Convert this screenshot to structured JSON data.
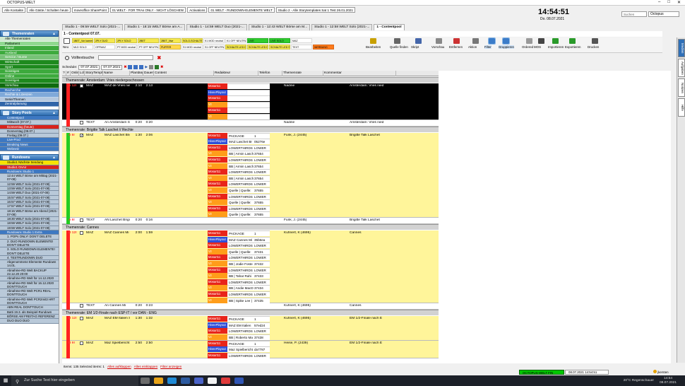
{
  "window": {
    "title": "OCTOPUS-WELT"
  },
  "shortcuts": [
    "Alle Kontakte",
    "Alle Gäste / Schalten heute",
    "moveoffice SharePoint",
    "01 WELT - FOR TRAs ONLY - NICHT LÖSCHEN!",
    "Activations",
    "01 WELT - RUNDOWN-ELEMENTE WELT",
    "Studio 2 - Alle Storytemplates Sat 1 Test 26.01.2021"
  ],
  "clock": {
    "time": "14:54:51",
    "date": "Do. 08.07.2021"
  },
  "top_search": {
    "placeholder": "Suchen",
    "selected": "Octopus"
  },
  "tabs": [
    {
      "label": "Studio 1 - 09:59 WELT Solo (2021-...",
      "active": false
    },
    {
      "label": "Studio 1 - 18:15 WELT Börse am A...",
      "active": false
    },
    {
      "label": "Studio 1 - 14:59 WELT Duo (2021-...",
      "active": false
    },
    {
      "label": "Studio 1 - 12:43 WELT Börse am M...",
      "active": false
    },
    {
      "label": "Studio 1 - 12:58 WELT Solo (2021-...",
      "active": false
    },
    {
      "label": "1 - Contentpool",
      "active": true
    }
  ],
  "contentpool_header": "1 - Contentpool 07.07.",
  "toolbar": {
    "neu": "Neu",
    "buttons": [
      {
        "label": "1BET_Vor kamera 1",
        "color": "#f5e84e"
      },
      {
        "label": "2PLY DUO",
        "color": "#f5e84e"
      },
      {
        "label": "2PLY SOLO",
        "color": "#f5e84e"
      },
      {
        "label": "2BET",
        "color": "#f5e84e"
      },
      {
        "label": "2BET_Nwr",
        "color": "#f5e84e"
      },
      {
        "label": "SOLO-SCHALTE",
        "color": "#f5e84e"
      },
      {
        "label": "K1 MOD neutral",
        "color": "#ffffff"
      },
      {
        "label": "K1 OFF NEUTRAL",
        "color": "#ffffff"
      },
      {
        "label": "LIVE",
        "color": "#2ecc2e"
      },
      {
        "label": "LIVE SOLO",
        "color": "#2ecc2e"
      },
      {
        "label": "MAZ",
        "color": "#ffffff"
      },
      {
        "label": "MLD SOLO",
        "color": "#ffffff"
      },
      {
        "label": "OFFMAZ",
        "color": "#ffffff"
      },
      {
        "label": "PT MOD neutral",
        "color": "#ffffff"
      },
      {
        "label": "PT OFF NEUTRAL",
        "color": "#ffffff"
      },
      {
        "label": "PUFFER",
        "color": "#ffd84a"
      },
      {
        "label": "S1 MOD neutral",
        "color": "#ffffff"
      },
      {
        "label": "S1 OFF NEUTRAL",
        "color": "#ffffff"
      },
      {
        "label": "SCHALTE LED DEFAULT",
        "color": "#f5e84e"
      },
      {
        "label": "SCHALTE LED DUO SLED",
        "color": "#f5e84e"
      },
      {
        "label": "SCHALTE LED SOLO SLED",
        "color": "#f5e84e"
      },
      {
        "label": "TEXT",
        "color": "#ffffff"
      },
      {
        "label": "WERBUNG",
        "color": "#ff7a1a"
      }
    ],
    "actions": [
      "Bearbeiten",
      "Quelle finden",
      "Skript",
      "Vorschau",
      "Entfernen",
      "Aktion",
      "Filter",
      "Gruppieren",
      "Ordered",
      "MOS",
      "Importieren",
      "Exportieren",
      "Drucken"
    ],
    "volltext": "Volltextsuche"
  },
  "schedule": {
    "label": "Schedule:",
    "from": "07.07.2021",
    "to": "07.07.2021"
  },
  "sidebar": {
    "themen_header": "Themenraten",
    "themen": [
      {
        "label": "Alle Themenraten",
        "color": "#cfe8d0",
        "text": "#000"
      },
      {
        "label": "Parlament",
        "color": "#8fd88f",
        "text": "#000"
      },
      {
        "label": "Inland",
        "color": "#3daa3d",
        "text": "#fff"
      },
      {
        "label": "Ausland",
        "color": "#3daa3d",
        "text": "#fff"
      },
      {
        "label": "Service / Bunte",
        "color": "#77c277",
        "text": "#fff"
      },
      {
        "label": "Wirtschaft",
        "color": "#1e8a1e",
        "text": "#fff"
      },
      {
        "label": "Sport",
        "color": "#1e8a1e",
        "text": "#fff"
      },
      {
        "label": "Sonstiges",
        "color": "#3daa3d",
        "text": "#fff"
      },
      {
        "label": "Online",
        "color": "#3daa3d",
        "text": "#fff"
      },
      {
        "label": "Sonstiges",
        "color": "#1e8a1e",
        "text": "#fff"
      },
      {
        "label": "Vorschau",
        "color": "#0f6b0f",
        "text": "#fff"
      },
      {
        "label": "Recherche",
        "color": "#3d78c2",
        "text": "#fff"
      },
      {
        "label": "Rechte & Lizenzen",
        "color": "#7fa9d9",
        "text": "#fff"
      },
      {
        "label": "Serie/Themen",
        "color": "#b5c8de",
        "text": "#000"
      },
      {
        "label": "Zentralplanung",
        "color": "#2f64a8",
        "text": "#fff"
      }
    ],
    "story_header": "Story Pools",
    "storypools": [
      {
        "label": "Contentpool",
        "cls": "blue"
      },
      {
        "label": "Mittwoch (07.07.)",
        "cls": ""
      },
      {
        "label": "Donnerstag (heute)",
        "cls": "red"
      },
      {
        "label": "Donnerstag (08.07.)",
        "cls": ""
      },
      {
        "label": "Freitag (09.07.)",
        "cls": ""
      },
      {
        "label": "Live-Prod",
        "cls": "blue"
      },
      {
        "label": "Breaking News",
        "cls": "blue"
      },
      {
        "label": "Webnetz",
        "cls": "blue"
      }
    ],
    "rundown_header": "Rundowns",
    "rundowns": [
      {
        "label": "Studio1 Nächste Sendung",
        "cls": "yellow"
      },
      {
        "label": "Studio1 OnAir",
        "cls": "red"
      },
      {
        "label": "Rundowns Studio 1",
        "cls": "blue"
      },
      {
        "label": "12:44 WELT Börse am Mittag (2021-07-08)",
        "cls": ""
      },
      {
        "label": "12:59 WELT Solo (2021-07-08)",
        "cls": ""
      },
      {
        "label": "13:59 WELT Solo (2021-07-08)",
        "cls": ""
      },
      {
        "label": "14:59 WELT Duo (2021-07-08)",
        "cls": ""
      },
      {
        "label": "15:57 WELT Solo (2021-07-08)",
        "cls": ""
      },
      {
        "label": "16:57 WELT Solo (2021-07-08)",
        "cls": ""
      },
      {
        "label": "17:57 WELT Solo (2021-07-08)",
        "cls": ""
      },
      {
        "label": "18:15 WELT Börse am Abend (2021-07-08)",
        "cls": ""
      },
      {
        "label": "18:30 WELT Solo (2021-07-08)",
        "cls": ""
      },
      {
        "label": "18:59 WELT Solo (2021-07-08)",
        "cls": ""
      },
      {
        "label": "19:59 WELT Solo (2021-07-08)",
        "cls": ""
      },
      {
        "label": "Rundowns Studio 1 Extra",
        "cls": "blue"
      },
      {
        "label": "1. POPs ONLY! DON'T DELETE",
        "cls": ""
      },
      {
        "label": "2. DUO RUNDOWN ELEMENTE! DON'T DELETE",
        "cls": ""
      },
      {
        "label": "3. SOLO RUNDOWN ELEMENTE! DON'T DELETE",
        "cls": ""
      },
      {
        "label": "4. TESTRUNDOWN DUO",
        "cls": ""
      },
      {
        "label": "Abgenommene Elemente Rundown 14.01.",
        "cls": ""
      },
      {
        "label": "Abnahme-RD Welt BACKUP 22.12.20 20:00",
        "cls": ""
      },
      {
        "label": "Abnahme-RD Welt für 14.12.2020",
        "cls": ""
      },
      {
        "label": "Abnahme-RD Welt für 16.12.2020 DONTTOUCH",
        "cls": ""
      },
      {
        "label": "Abnahme-RD Welt PCR1 REAL DONTTOUCH",
        "cls": ""
      },
      {
        "label": "Abnahme-RD Welt PCR2mit3 HRT DONTTOUCH",
        "cls": ""
      },
      {
        "label": "ABN REAL DONTTOUCH",
        "cls": ""
      },
      {
        "label": "Batti 19.3. als Beispiel-Rundown",
        "cls": ""
      },
      {
        "label": "BÖRSE AM FREITAG REFERENZ",
        "cls": ""
      },
      {
        "label": "DUO DUO DUO",
        "cls": ""
      }
    ]
  },
  "grid": {
    "columns": [
      "?",
      "#",
      "Online",
      "Lck",
      "StoryTemplate",
      "Name",
      "Plantänge",
      "Dauer",
      "Content",
      "Redakteur",
      "Telefon",
      "Themenrate",
      "Kommentar"
    ],
    "sections": [
      {
        "title": "Themenrate: Amsterdam: Vries niedergeschossen",
        "rows": [
          {
            "bg": "#000000",
            "fg": "#ffffff",
            "lane": "#ff2020",
            "flag": "A 12!",
            "template": "MAZ",
            "name": "MAZ de Vries niedergesch",
            "plan": "2:10",
            "dur": "2:13",
            "redakteur": "Nadine",
            "thema": "Amsterdam: Vries nied",
            "checked": false,
            "content": [
              [
                "Mosart11",
                "PACKAGE",
                "1"
              ],
              [
                "HiveePlayout",
                "MAZ de Vries nied",
                "4953e"
              ],
              [
                "Mosart11",
                "LOWERTHIRDS",
                "LOWER"
              ],
              [
                "Vz",
                "BB | Ursula von",
                "37473"
              ],
              [
                "Mosart11",
                "LOWERTHIRDS",
                "LOWER"
              ],
              [
                "Vz",
                "BB | König Willem",
                "37474"
              ]
            ]
          },
          {
            "bg": "#ffffff",
            "fg": "#000",
            "lane": "#ff2020",
            "flag": "",
            "template": "TEXT",
            "name": "An Amsterdam Schusse",
            "plan": "0:20",
            "dur": "0:20",
            "redakteur": "Nadine",
            "thema": "Amsterdam: Vries nied",
            "checked": false,
            "content": []
          }
        ]
      },
      {
        "title": "Themenrate: Brigitte Talk Laschet // Rechte",
        "rows": [
          {
            "bg": "#fff59a",
            "fg": "#000",
            "lane": "#22cc22",
            "flag": "A 6!",
            "template": "MAZ",
            "name": "MAZ Laschet Brigitte Tal",
            "plan": "1:30",
            "dur": "2:06",
            "redakteur": "Funk, J. (2445)",
            "thema": "Brigitte Talk Laschet",
            "checked": true,
            "content": [
              [
                "Mosart11",
                "PACKAGE",
                "1"
              ],
              [
                "HiveePlayout",
                "MAZ Laschet Br",
                "05276e"
              ],
              [
                "Mosart11",
                "LOWERTHIRDS",
                "LOWER"
              ],
              [
                "Vz",
                "BB | Armin Lasch",
                "37654"
              ],
              [
                "Mosart11",
                "LOWERTHIRDS",
                "LOWER"
              ],
              [
                "Vz",
                "BB | Armin Lasch",
                "37654"
              ],
              [
                "Mosart11",
                "LOWERTHIRDS",
                "LOWER"
              ],
              [
                "Vz",
                "BB | Armin Lasch",
                "37654"
              ],
              [
                "Mosart11",
                "LOWERTHIRDS",
                "LOWER"
              ],
              [
                "Vz",
                "Quelle | Quelle:",
                "37655"
              ],
              [
                "Mosart11",
                "LOWERTHIRDS",
                "LOWER"
              ],
              [
                "Vz",
                "Quelle | Quelle:",
                "37655"
              ],
              [
                "Mosart11",
                "LOWERTHIRDS",
                "LOWER"
              ],
              [
                "Vz",
                "Quelle | Quelle:",
                "37655"
              ]
            ]
          },
          {
            "bg": "#ffffff",
            "fg": "#000",
            "lane": "#22cc22",
            "flag": "A 6!",
            "template": "TEXT",
            "name": "AN Laschet Brigitte Talk",
            "plan": "0:20",
            "dur": "0:16",
            "redakteur": "Funk, J. (2445)",
            "thema": "Brigitte Talk Laschet",
            "checked": false,
            "content": []
          }
        ]
      },
      {
        "title": "Themenrate: Cannes",
        "rows": [
          {
            "bg": "#fff59a",
            "fg": "#000",
            "lane": "#ff2020",
            "flag": "B 12!",
            "template": "MAZ",
            "name": "MAZ Cannes Mi 1005",
            "plan": "2:00",
            "dur": "1:59",
            "redakteur": "Kuhnert, K (4695)",
            "thema": "Cannes",
            "checked": false,
            "content": [
              [
                "Mosart11",
                "PACKAGE",
                "1"
              ],
              [
                "HiveePlayout",
                "MAZ Cannes Mi",
                "35b6ea"
              ],
              [
                "Mosart11",
                "LOWERTHIRDS",
                "LOWER"
              ],
              [
                "Vz",
                "Quelle | Quelle:",
                "37431"
              ],
              [
                "Mosart11",
                "LOWERTHIRDS",
                "LOWER"
              ],
              [
                "Vz",
                "BB | Jodie Foste",
                "37432"
              ],
              [
                "Mosart11",
                "LOWERTHIRDS",
                "LOWER"
              ],
              [
                "Vz",
                "BB | Tahar Rahi",
                "37433"
              ],
              [
                "Mosart11",
                "LOWERTHIRDS",
                "LOWER"
              ],
              [
                "Vz",
                "BB | Andie MacD",
                "37434"
              ],
              [
                "Mosart11",
                "LOWERTHIRDS",
                "LOWER"
              ],
              [
                "Vz",
                "BB | Spike Lee |",
                "37435"
              ]
            ]
          },
          {
            "bg": "#ffffff",
            "fg": "#000",
            "lane": "#ff2020",
            "flag": "",
            "template": "TEXT",
            "name": "An Cannes Mi",
            "plan": "0:20",
            "dur": "0:23",
            "redakteur": "Kuhnert, K (4695)",
            "thema": "Cannes",
            "checked": false,
            "content": []
          }
        ]
      },
      {
        "title": "Themenrate: EM 1/2-Finale nach ESP-IT / vor DAN - ENG",
        "rows": [
          {
            "bg": "#fff59a",
            "fg": "#000",
            "lane": "#ff2020",
            "flag": "B 12!",
            "template": "MAZ",
            "name": "MAZ EM Italien Spanien",
            "plan": "1:30",
            "dur": "1:32",
            "redakteur": "Kuhnert, K (4695)",
            "thema": "EM 1/2-Finale nach E",
            "checked": false,
            "content": [
              [
                "Mosart11",
                "PACKAGE",
                "1"
              ],
              [
                "HiveePlayout",
                "MAZ EM Italien",
                "57ed24"
              ],
              [
                "Mosart11",
                "LOWERTHIRDS",
                "LOWER"
              ],
              [
                "Vz",
                "BB | Roberto Ma",
                "37438"
              ]
            ]
          },
          {
            "bg": "#fff59a",
            "fg": "#000",
            "lane": "#ff2020",
            "flag": "B 9!",
            "template": "MAZ",
            "name": "Maz Spielbericht Italien v",
            "plan": "2:50",
            "dur": "2:50",
            "redakteur": "Heise, P. (2439)",
            "thema": "EM 1/2-Finale nach E",
            "checked": false,
            "content": [
              [
                "Mosart11",
                "PACKAGE",
                "1"
              ],
              [
                "HiveePlayout",
                "Maz Spielbericht",
                "da7787"
              ],
              [
                "Mosart11",
                "LOWERTHIRDS",
                "LOWER"
              ]
            ]
          }
        ]
      }
    ]
  },
  "right_tabs": [
    "Medien",
    "Aufgaben",
    "Notizen",
    "Hilfe"
  ],
  "status": {
    "items": "Items: 135 Selected items: 1",
    "links": [
      "Alles aufklappen",
      "Alles einklappen",
      "Filter anzeigen"
    ],
    "server": "OCTOPUS-WELT FIN",
    "datetime": "08.07.2021 14:54:51",
    "user": "jkersten"
  },
  "taskbar": {
    "search": "Zur Suche Text hier eingeben",
    "weather": "20°C Regenschauer",
    "time": "14:54",
    "date": "08.07.2021"
  }
}
